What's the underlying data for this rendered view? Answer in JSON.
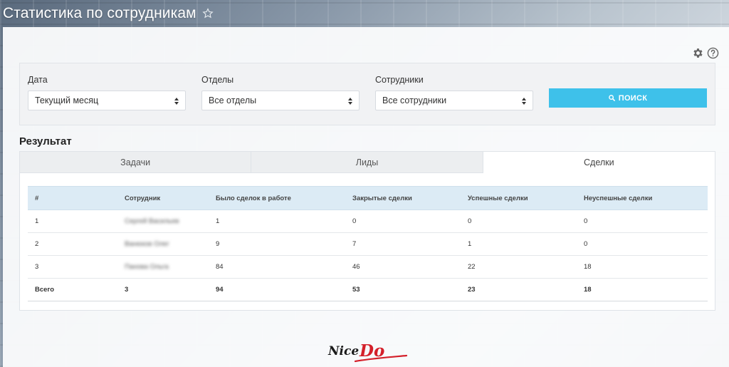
{
  "header": {
    "title": "Статистика по сотрудникам",
    "star_icon": "star-outline-icon"
  },
  "tools": {
    "settings_icon": "gear-icon",
    "help_icon": "question-circle-icon"
  },
  "filters": {
    "date": {
      "label": "Дата",
      "value": "Текущий месяц"
    },
    "departments": {
      "label": "Отделы",
      "value": "Все отделы"
    },
    "employees": {
      "label": "Сотрудники",
      "value": "Все сотрудники"
    },
    "search_button": {
      "label": "ПОИСК",
      "icon": "search-icon"
    }
  },
  "result": {
    "title": "Результат",
    "tabs": [
      {
        "label": "Задачи",
        "active": false
      },
      {
        "label": "Лиды",
        "active": false
      },
      {
        "label": "Сделки",
        "active": true
      }
    ],
    "columns": [
      "#",
      "Сотрудник",
      "Было сделок в работе",
      "Закрытые сделки",
      "Успешные сделки",
      "Неуспешные сделки"
    ],
    "rows": [
      {
        "num": "1",
        "employee": "Сергей Васильев",
        "in_work": "1",
        "closed": "0",
        "successful": "0",
        "failed": "0"
      },
      {
        "num": "2",
        "employee": "Ванюков Олег",
        "in_work": "9",
        "closed": "7",
        "successful": "1",
        "failed": "0"
      },
      {
        "num": "3",
        "employee": "Панова Ольга",
        "in_work": "84",
        "closed": "46",
        "successful": "22",
        "failed": "18"
      }
    ],
    "total": {
      "label": "Всего",
      "employees": "3",
      "in_work": "94",
      "closed": "53",
      "successful": "23",
      "failed": "18"
    }
  },
  "logo": {
    "text_part1": "Nice",
    "text_part2": "Do"
  },
  "colors": {
    "accent": "#3ec1ea",
    "table_header": "#dcebf5",
    "logo_red": "#d4202a"
  }
}
